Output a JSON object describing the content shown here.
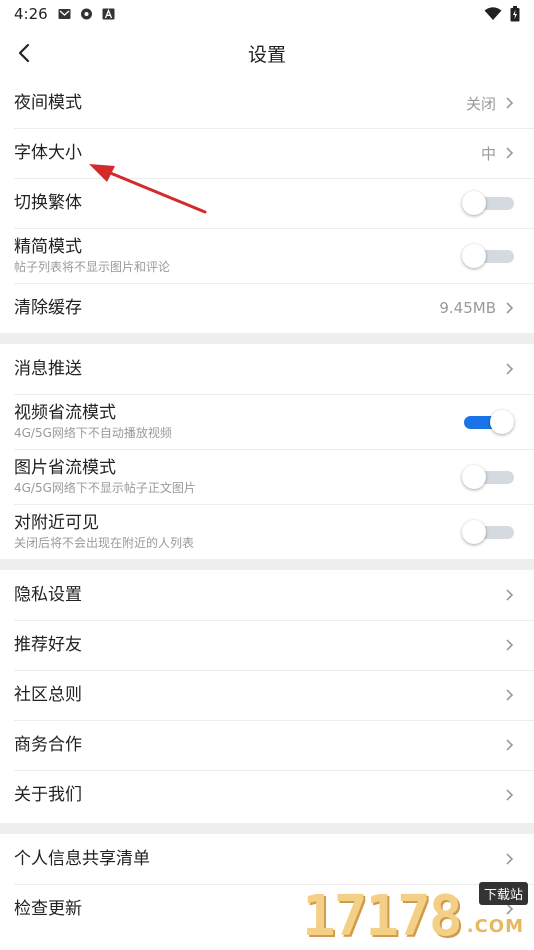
{
  "status_bar": {
    "time": "4:26"
  },
  "nav": {
    "title": "设置"
  },
  "group1": [
    {
      "label": "夜间模式",
      "value": "关闭"
    },
    {
      "label": "字体大小",
      "value": "中"
    },
    {
      "label": "切换繁体",
      "toggle": false
    },
    {
      "label": "精简模式",
      "sub": "帖子列表将不显示图片和评论",
      "toggle": false
    },
    {
      "label": "清除缓存",
      "value": "9.45MB"
    }
  ],
  "group2": [
    {
      "label": "消息推送"
    },
    {
      "label": "视频省流模式",
      "sub": "4G/5G网络下不自动播放视频",
      "toggle": true
    },
    {
      "label": "图片省流模式",
      "sub": "4G/5G网络下不显示帖子正文图片",
      "toggle": false
    },
    {
      "label": "对附近可见",
      "sub": "关闭后将不会出现在附近的人列表",
      "toggle": false
    }
  ],
  "group3": [
    {
      "label": "隐私设置"
    },
    {
      "label": "推荐好友"
    },
    {
      "label": "社区总则"
    },
    {
      "label": "商务合作"
    },
    {
      "label": "关于我们"
    }
  ],
  "group4": [
    {
      "label": "个人信息共享清单"
    },
    {
      "label": "检查更新"
    }
  ],
  "watermark": {
    "digits": "17178",
    "tag": "下载站",
    "domain": ".COM"
  },
  "colors": {
    "accent": "#1a73e8",
    "separator": "#eeeeee",
    "annotation": "#d42a2a"
  }
}
